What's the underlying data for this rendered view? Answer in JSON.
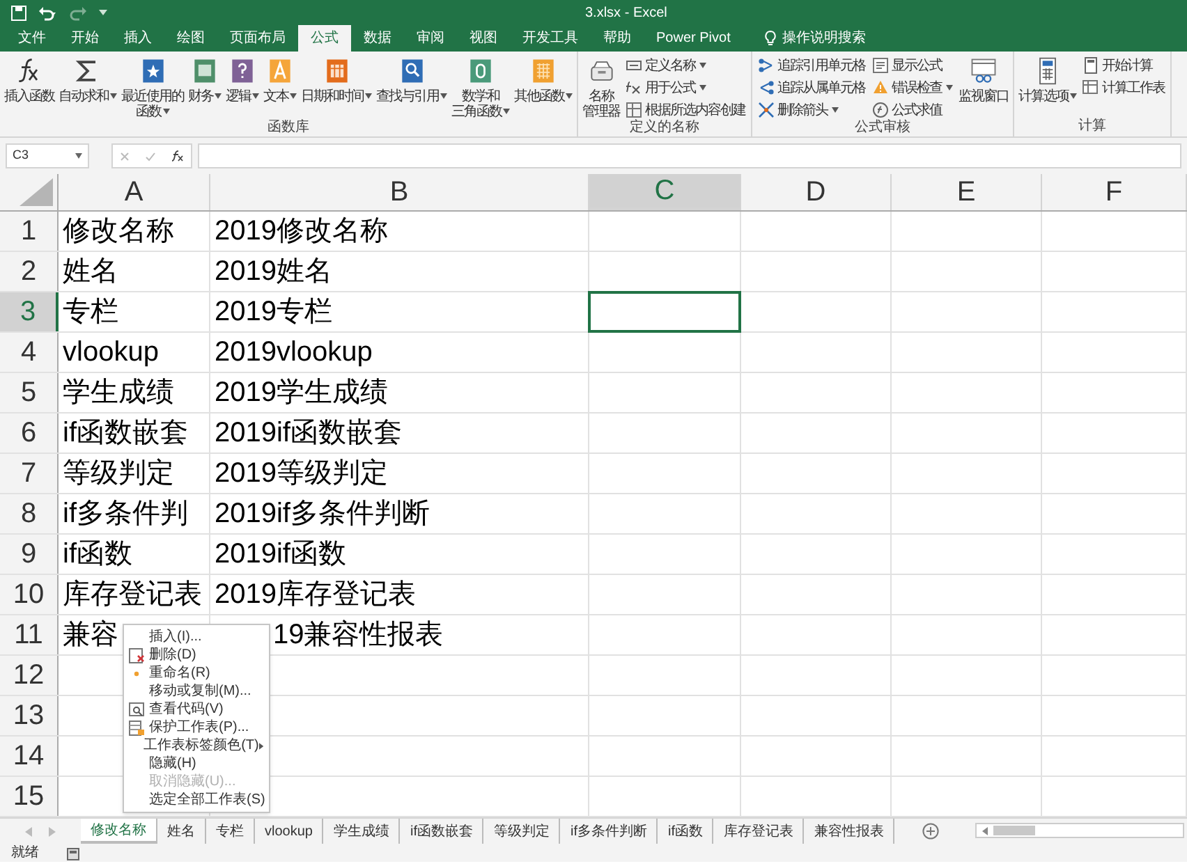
{
  "window": {
    "title": "3.xlsx  -  Excel"
  },
  "ribbon_tabs": [
    {
      "label": "文件",
      "selected": false
    },
    {
      "label": "开始",
      "selected": false
    },
    {
      "label": "插入",
      "selected": false
    },
    {
      "label": "绘图",
      "selected": false
    },
    {
      "label": "页面布局",
      "selected": false
    },
    {
      "label": "公式",
      "selected": true
    },
    {
      "label": "数据",
      "selected": false
    },
    {
      "label": "审阅",
      "selected": false
    },
    {
      "label": "视图",
      "selected": false
    },
    {
      "label": "开发工具",
      "selected": false
    },
    {
      "label": "帮助",
      "selected": false
    },
    {
      "label": "Power Pivot",
      "selected": false
    }
  ],
  "tell_me": {
    "placeholder": "操作说明搜索"
  },
  "ribbon_groups": [
    {
      "label": "函数库",
      "columns": [
        {
          "kind": "large",
          "lines": [
            "插入函数"
          ],
          "dropdown": false
        },
        {
          "kind": "large",
          "lines": [
            "自动求和"
          ],
          "dropdown": true
        },
        {
          "kind": "large",
          "lines": [
            "最近使用的",
            "函数"
          ],
          "dropdown": true
        },
        {
          "kind": "large",
          "lines": [
            "财务"
          ],
          "dropdown": true
        },
        {
          "kind": "large",
          "lines": [
            "逻辑"
          ],
          "dropdown": true
        },
        {
          "kind": "large",
          "lines": [
            "文本"
          ],
          "dropdown": true
        },
        {
          "kind": "large",
          "lines": [
            "日期和时间"
          ],
          "dropdown": true
        },
        {
          "kind": "large",
          "lines": [
            "查找与引用"
          ],
          "dropdown": true
        },
        {
          "kind": "large",
          "lines": [
            "数学和",
            "三角函数"
          ],
          "dropdown": true
        },
        {
          "kind": "large",
          "lines": [
            "其他函数"
          ],
          "dropdown": true
        }
      ]
    },
    {
      "label": "定义的名称",
      "columns": [
        {
          "kind": "large",
          "lines": [
            "名称",
            "管理器"
          ],
          "dropdown": false
        },
        {
          "kind": "stack",
          "items": [
            {
              "label": "定义名称",
              "dropdown": true
            },
            {
              "label": "用于公式",
              "dropdown": true
            },
            {
              "label": "根据所选内容创建",
              "dropdown": false
            }
          ]
        }
      ]
    },
    {
      "label": "公式审核",
      "columns": [
        {
          "kind": "stack",
          "items": [
            {
              "label": "追踪引用单元格",
              "dropdown": false
            },
            {
              "label": "追踪从属单元格",
              "dropdown": false
            },
            {
              "label": "删除箭头",
              "dropdown": true
            }
          ]
        },
        {
          "kind": "stack",
          "items": [
            {
              "label": "显示公式",
              "dropdown": false
            },
            {
              "label": "错误检查",
              "dropdown": true
            },
            {
              "label": "公式求值",
              "dropdown": false
            }
          ]
        },
        {
          "kind": "large",
          "lines": [
            "监视窗口"
          ],
          "dropdown": false
        }
      ]
    },
    {
      "label": "计算",
      "columns": [
        {
          "kind": "large",
          "lines": [
            "计算选项"
          ],
          "dropdown": true
        },
        {
          "kind": "stack",
          "items": [
            {
              "label": "开始计算",
              "dropdown": false
            },
            {
              "label": "计算工作表",
              "dropdown": false
            }
          ]
        }
      ]
    }
  ],
  "name_box": {
    "value": "C3"
  },
  "columns": [
    {
      "label": "A",
      "selected": false
    },
    {
      "label": "B",
      "selected": false
    },
    {
      "label": "C",
      "selected": true
    },
    {
      "label": "D",
      "selected": false
    },
    {
      "label": "E",
      "selected": false
    },
    {
      "label": "F",
      "selected": false
    }
  ],
  "rows": [
    {
      "label": "1",
      "selected": false,
      "cells": [
        "修改名称",
        "2019修改名称"
      ]
    },
    {
      "label": "2",
      "selected": false,
      "cells": [
        "姓名",
        "2019姓名"
      ]
    },
    {
      "label": "3",
      "selected": true,
      "cells": [
        "专栏",
        "2019专栏"
      ]
    },
    {
      "label": "4",
      "selected": false,
      "cells": [
        "vlookup",
        "2019vlookup"
      ]
    },
    {
      "label": "5",
      "selected": false,
      "cells": [
        "学生成绩",
        "2019学生成绩"
      ]
    },
    {
      "label": "6",
      "selected": false,
      "cells": [
        "if函数嵌套",
        "2019if函数嵌套"
      ]
    },
    {
      "label": "7",
      "selected": false,
      "cells": [
        "等级判定",
        "2019等级判定"
      ]
    },
    {
      "label": "8",
      "selected": false,
      "cells": [
        "if多条件判",
        "2019if多条件判断"
      ]
    },
    {
      "label": "9",
      "selected": false,
      "cells": [
        "if函数",
        "2019if函数"
      ]
    },
    {
      "label": "10",
      "selected": false,
      "cells": [
        "库存登记表",
        "2019库存登记表"
      ]
    },
    {
      "label": "11",
      "selected": false,
      "cells": [
        "兼容",
        "19兼容性报表"
      ]
    },
    {
      "label": "12",
      "selected": false
    },
    {
      "label": "13",
      "selected": false
    },
    {
      "label": "14",
      "selected": false
    },
    {
      "label": "15",
      "selected": false
    }
  ],
  "context_menu": [
    {
      "label": "插入(I)...",
      "disabled": false,
      "submenu": false
    },
    {
      "label": "删除(D)",
      "disabled": false,
      "submenu": false
    },
    {
      "label": "重命名(R)",
      "disabled": false,
      "submenu": false
    },
    {
      "label": "移动或复制(M)...",
      "disabled": false,
      "submenu": false
    },
    {
      "label": "查看代码(V)",
      "disabled": false,
      "submenu": false
    },
    {
      "label": "保护工作表(P)...",
      "disabled": false,
      "submenu": false
    },
    {
      "label": "工作表标签颜色(T)",
      "disabled": false,
      "submenu": true
    },
    {
      "label": "隐藏(H)",
      "disabled": false,
      "submenu": false
    },
    {
      "label": "取消隐藏(U)...",
      "disabled": true,
      "submenu": false
    },
    {
      "label": "选定全部工作表(S)",
      "disabled": false,
      "submenu": false
    }
  ],
  "sheet_tabs": [
    {
      "label": "修改名称",
      "selected": true
    },
    {
      "label": "姓名",
      "selected": false
    },
    {
      "label": "专栏",
      "selected": false
    },
    {
      "label": "vlookup",
      "selected": false
    },
    {
      "label": "学生成绩",
      "selected": false
    },
    {
      "label": "if函数嵌套",
      "selected": false
    },
    {
      "label": "等级判定",
      "selected": false
    },
    {
      "label": "if多条件判断",
      "selected": false
    },
    {
      "label": "if函数",
      "selected": false
    },
    {
      "label": "库存登记表",
      "selected": false
    },
    {
      "label": "兼容性报表",
      "selected": false
    }
  ],
  "status_bar": {
    "text": "就绪"
  }
}
